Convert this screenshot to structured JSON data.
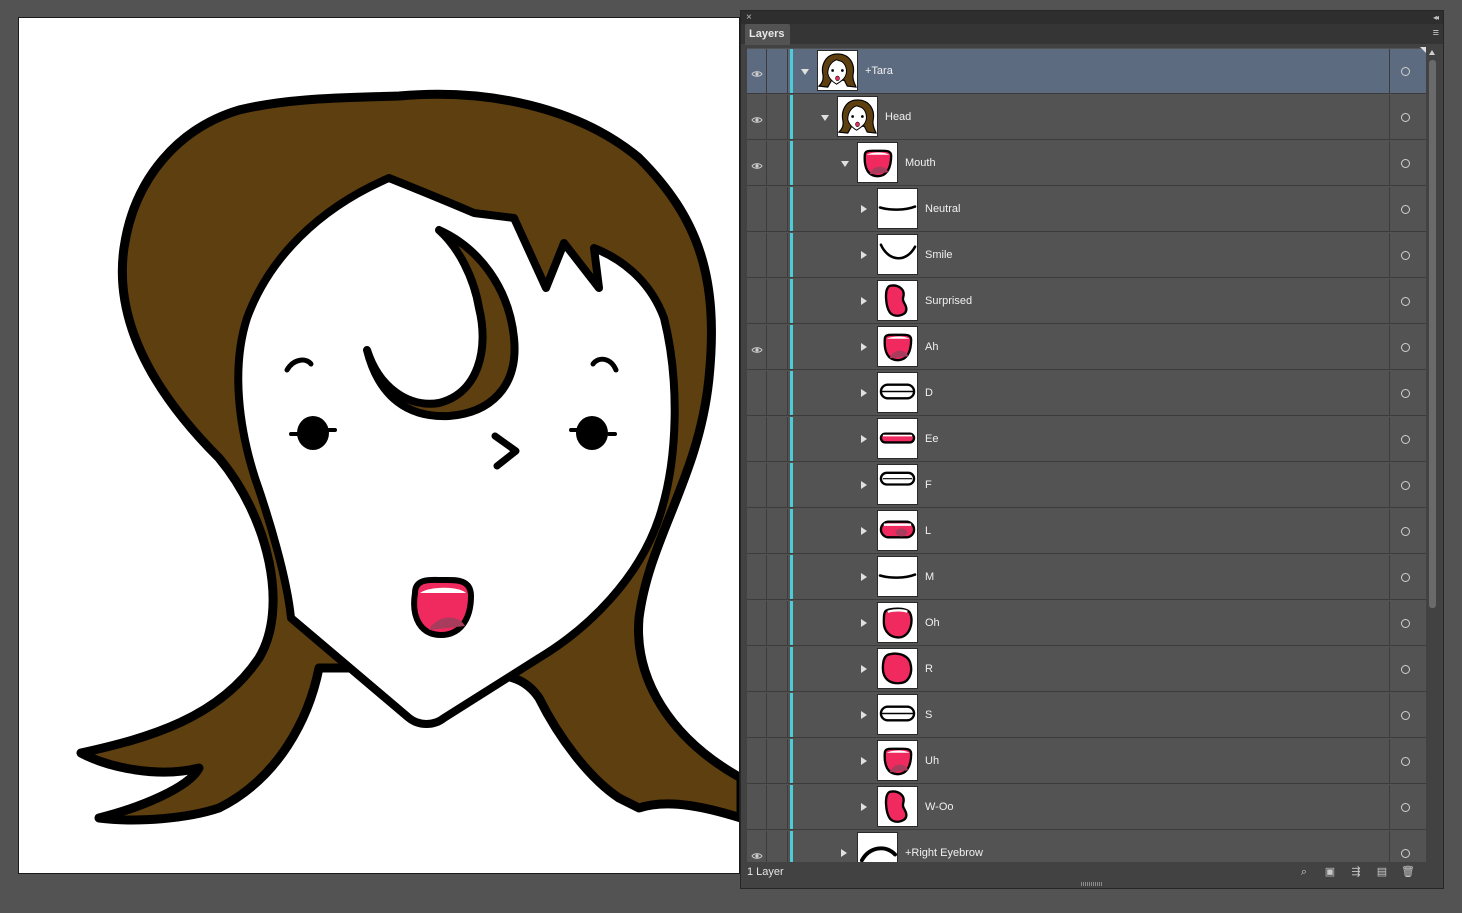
{
  "panel": {
    "close_glyph": "×",
    "collapse_glyph": "◂◂",
    "tab_label": "Layers",
    "menu_glyph": "≡",
    "footer_count": "1 Layer"
  },
  "layers": [
    {
      "name": "+Tara",
      "level": 0,
      "visible": true,
      "open": true,
      "thumb": "face-thumbnail",
      "selected": true
    },
    {
      "name": "Head",
      "level": 1,
      "visible": true,
      "open": true,
      "thumb": "face-thumbnail"
    },
    {
      "name": "Mouth",
      "level": 2,
      "visible": true,
      "open": true,
      "thumb": "mouth-open-thumbnail"
    },
    {
      "name": "Neutral",
      "level": 3,
      "visible": false,
      "open": false,
      "thumb": "line-thumbnail"
    },
    {
      "name": "Smile",
      "level": 3,
      "visible": false,
      "open": false,
      "thumb": "smile-thumbnail"
    },
    {
      "name": "Surprised",
      "level": 3,
      "visible": false,
      "open": false,
      "thumb": "bean-thumbnail"
    },
    {
      "name": "Ah",
      "level": 3,
      "visible": true,
      "open": false,
      "thumb": "mouth-open-thumbnail"
    },
    {
      "name": "D",
      "level": 3,
      "visible": false,
      "open": false,
      "thumb": "teeth-thumbnail"
    },
    {
      "name": "Ee",
      "level": 3,
      "visible": false,
      "open": false,
      "thumb": "thin-mouth-thumbnail"
    },
    {
      "name": "F",
      "level": 3,
      "visible": false,
      "open": false,
      "thumb": "teeth-top-thumbnail"
    },
    {
      "name": "L",
      "level": 3,
      "visible": false,
      "open": false,
      "thumb": "tongue-thumbnail"
    },
    {
      "name": "M",
      "level": 3,
      "visible": false,
      "open": false,
      "thumb": "line-thumbnail"
    },
    {
      "name": "Oh",
      "level": 3,
      "visible": false,
      "open": false,
      "thumb": "oh-thumbnail"
    },
    {
      "name": "R",
      "level": 3,
      "visible": false,
      "open": false,
      "thumb": "round-thumbnail"
    },
    {
      "name": "S",
      "level": 3,
      "visible": false,
      "open": false,
      "thumb": "teeth-thumbnail"
    },
    {
      "name": "Uh",
      "level": 3,
      "visible": false,
      "open": false,
      "thumb": "mouth-open-thumbnail"
    },
    {
      "name": "W-Oo",
      "level": 3,
      "visible": false,
      "open": false,
      "thumb": "bean-thumbnail"
    },
    {
      "name": "+Right Eyebrow",
      "level": 2,
      "visible": true,
      "open": false,
      "thumb": "brow-thumbnail"
    }
  ],
  "footer_icons": [
    "locate-object-icon",
    "make-clipping-mask-icon",
    "create-sublayer-icon",
    "create-new-layer-icon",
    "delete-layer-icon"
  ],
  "colors": {
    "hair": "#5e3f0f",
    "mouth": "#f0295f",
    "tongue": "#a83c5c",
    "layer_color": "#4ecbd9",
    "selection": "#5d6b80"
  }
}
